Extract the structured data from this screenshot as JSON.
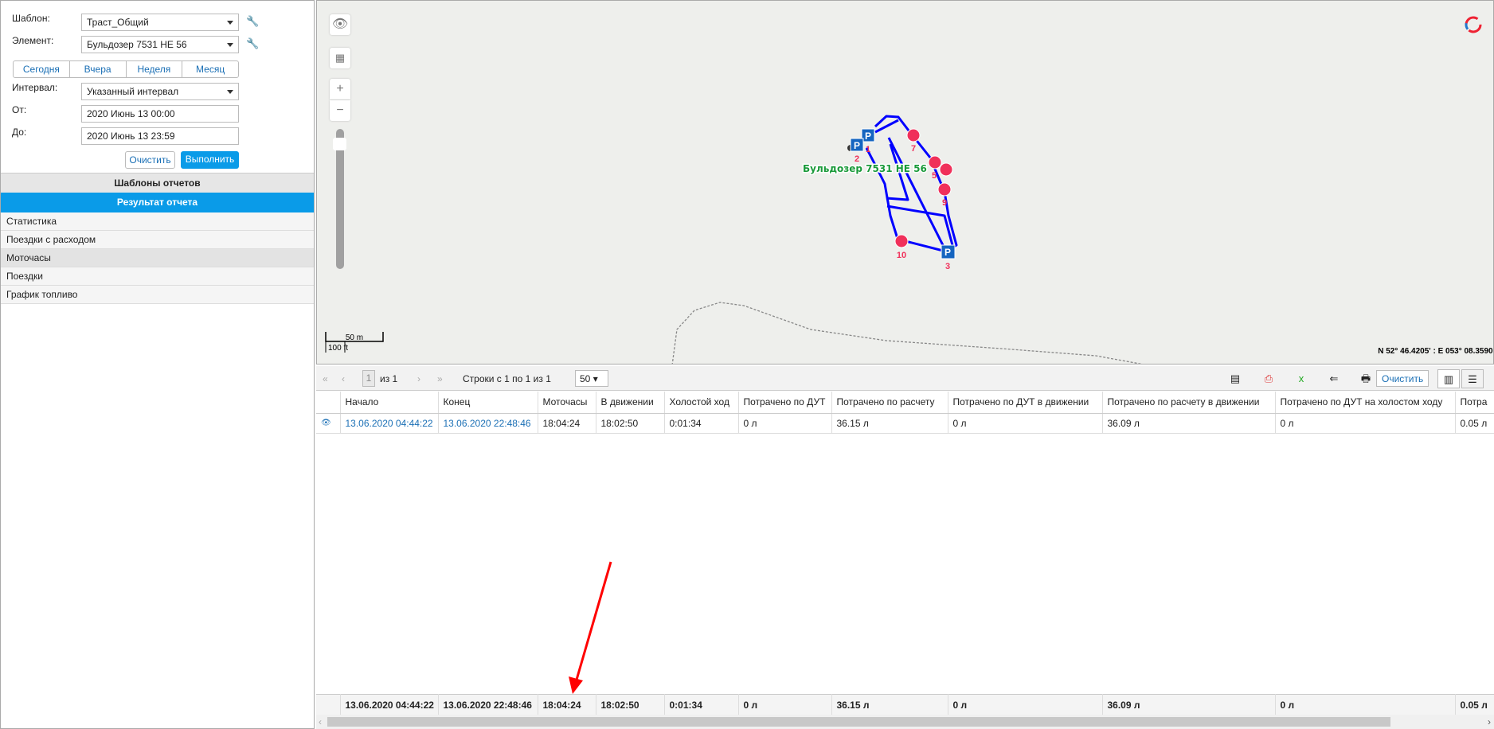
{
  "left": {
    "template_label": "Шаблон:",
    "template_value": "Траст_Общий",
    "element_label": "Элемент:",
    "element_value": "Бульдозер 7531 НЕ 56",
    "periods": [
      "Сегодня",
      "Вчера",
      "Неделя",
      "Месяц"
    ],
    "interval_label": "Интервал:",
    "interval_value": "Указанный интервал",
    "from_label": "От:",
    "from_value": "2020 Июнь 13 00:00",
    "to_label": "До:",
    "to_value": "2020 Июнь 13 23:59",
    "clear": "Очистить",
    "run": "Выполнить",
    "templates_header": "Шаблоны отчетов",
    "result_header": "Результат отчета",
    "reports": [
      "Статистика",
      "Поездки с расходом",
      "Моточасы",
      "Поездки",
      "График топливо"
    ]
  },
  "map": {
    "unit_label": "Бульдозер 7531 НЕ 56",
    "parking": [
      "1",
      "2",
      "3"
    ],
    "stops": [
      "7",
      "5",
      "9",
      "10"
    ],
    "scale_m": "50 m",
    "scale_ft": "100 ft",
    "coords": "N 52° 46.4205' : E 053° 08.3590'",
    "zoom_in": "+",
    "zoom_out": "−"
  },
  "toolbar": {
    "page": "1",
    "of": "из 1",
    "rows": "Строки с 1 по 1 из 1",
    "per_page": "50",
    "clear": "Очистить"
  },
  "table": {
    "headers": [
      "Начало",
      "Конец",
      "Моточасы",
      "В движении",
      "Холостой ход",
      "Потрачено по ДУТ",
      "Потрачено по расчету",
      "Потрачено по ДУТ в движении",
      "Потрачено по расчету в движении",
      "Потрачено по ДУТ на холостом ходу",
      "Потра"
    ],
    "row": [
      "13.06.2020 04:44:22",
      "13.06.2020 22:48:46",
      "18:04:24",
      "18:02:50",
      "0:01:34",
      "0 л",
      "36.15 л",
      "0 л",
      "36.09 л",
      "0 л",
      "0.05 л"
    ],
    "totals": [
      "13.06.2020 04:44:22",
      "13.06.2020 22:48:46",
      "18:04:24",
      "18:02:50",
      "0:01:34",
      "0 л",
      "36.15 л",
      "0 л",
      "36.09 л",
      "0 л",
      "0.05 л"
    ]
  },
  "colors": {
    "accent": "#0a9be8",
    "route": "#0000ff",
    "stop": "#f0305a",
    "parking": "#1565c0",
    "label": "#1a9a3a",
    "arrow": "#ff0000"
  }
}
